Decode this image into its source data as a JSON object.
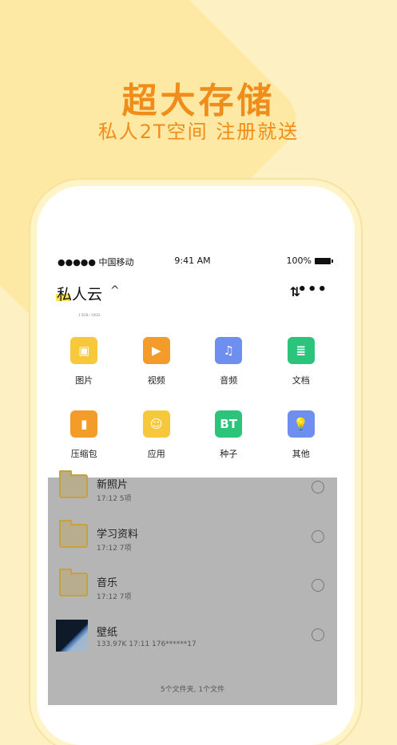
{
  "promo": {
    "headline": "超大存储",
    "subline": "私人2T空间  注册就送"
  },
  "statusbar": {
    "carrier": "●●●●● 中国移动",
    "time": "9:41 AM",
    "battery": "100%"
  },
  "header": {
    "title": "私人云",
    "chevron": "^",
    "sort_icon": "⇅",
    "more_icon": "•••"
  },
  "caption": "1.5GB / 10GB",
  "categories": [
    {
      "label": "图片",
      "icon": "image-icon",
      "color": "#f7c93a",
      "glyph": "▣"
    },
    {
      "label": "视频",
      "icon": "video-icon",
      "color": "#f39c2a",
      "glyph": "▶"
    },
    {
      "label": "音频",
      "icon": "audio-icon",
      "color": "#6f8ff0",
      "glyph": "♫"
    },
    {
      "label": "文档",
      "icon": "document-icon",
      "color": "#2bc47a",
      "glyph": "≣"
    },
    {
      "label": "压缩包",
      "icon": "archive-icon",
      "color": "#f39c2a",
      "glyph": "▮"
    },
    {
      "label": "应用",
      "icon": "app-icon",
      "color": "#f7c93a",
      "glyph": "☺"
    },
    {
      "label": "种子",
      "icon": "torrent-icon",
      "color": "#2bc47a",
      "glyph": "BT"
    },
    {
      "label": "其他",
      "icon": "other-icon",
      "color": "#6f8ff0",
      "glyph": "💡"
    }
  ],
  "files": [
    {
      "name": "新照片",
      "meta": "17:12   5项",
      "type": "folder"
    },
    {
      "name": "学习资料",
      "meta": "17:12   7项",
      "type": "folder"
    },
    {
      "name": "音乐",
      "meta": "17:12   7项",
      "type": "folder"
    },
    {
      "name": "壁纸",
      "meta": "133.97K   17:11   176******17",
      "type": "image"
    }
  ],
  "footer": "5个文件夹, 1个文件"
}
